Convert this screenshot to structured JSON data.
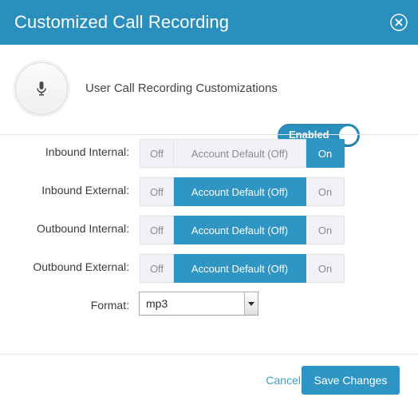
{
  "header": {
    "title": "Customized Call Recording",
    "close_icon": "close-circle-icon",
    "background_color": "#2b8fbd"
  },
  "top_section": {
    "avatar_icon": "microphone-icon",
    "label": "User Call Recording Customizations",
    "toggle": {
      "label": "Enabled",
      "state": "on",
      "color": "#2b8fbd"
    }
  },
  "form": {
    "rows": [
      {
        "label": "Inbound Internal:",
        "options": [
          "Off",
          "Account Default (Off)",
          "On"
        ],
        "selected_index": 2
      },
      {
        "label": "Inbound External:",
        "options": [
          "Off",
          "Account Default (Off)",
          "On"
        ],
        "selected_index": 1
      },
      {
        "label": "Outbound Internal:",
        "options": [
          "Off",
          "Account Default (Off)",
          "On"
        ],
        "selected_index": 1
      },
      {
        "label": "Outbound External:",
        "options": [
          "Off",
          "Account Default (Off)",
          "On"
        ],
        "selected_index": 1
      }
    ],
    "format": {
      "label": "Format:",
      "value": "mp3",
      "options": [
        "mp3"
      ]
    }
  },
  "footer": {
    "cancel_label": "Cancel",
    "save_label": "Save Changes",
    "save_color": "#2e95c4",
    "cancel_color": "#3f9ec9"
  }
}
